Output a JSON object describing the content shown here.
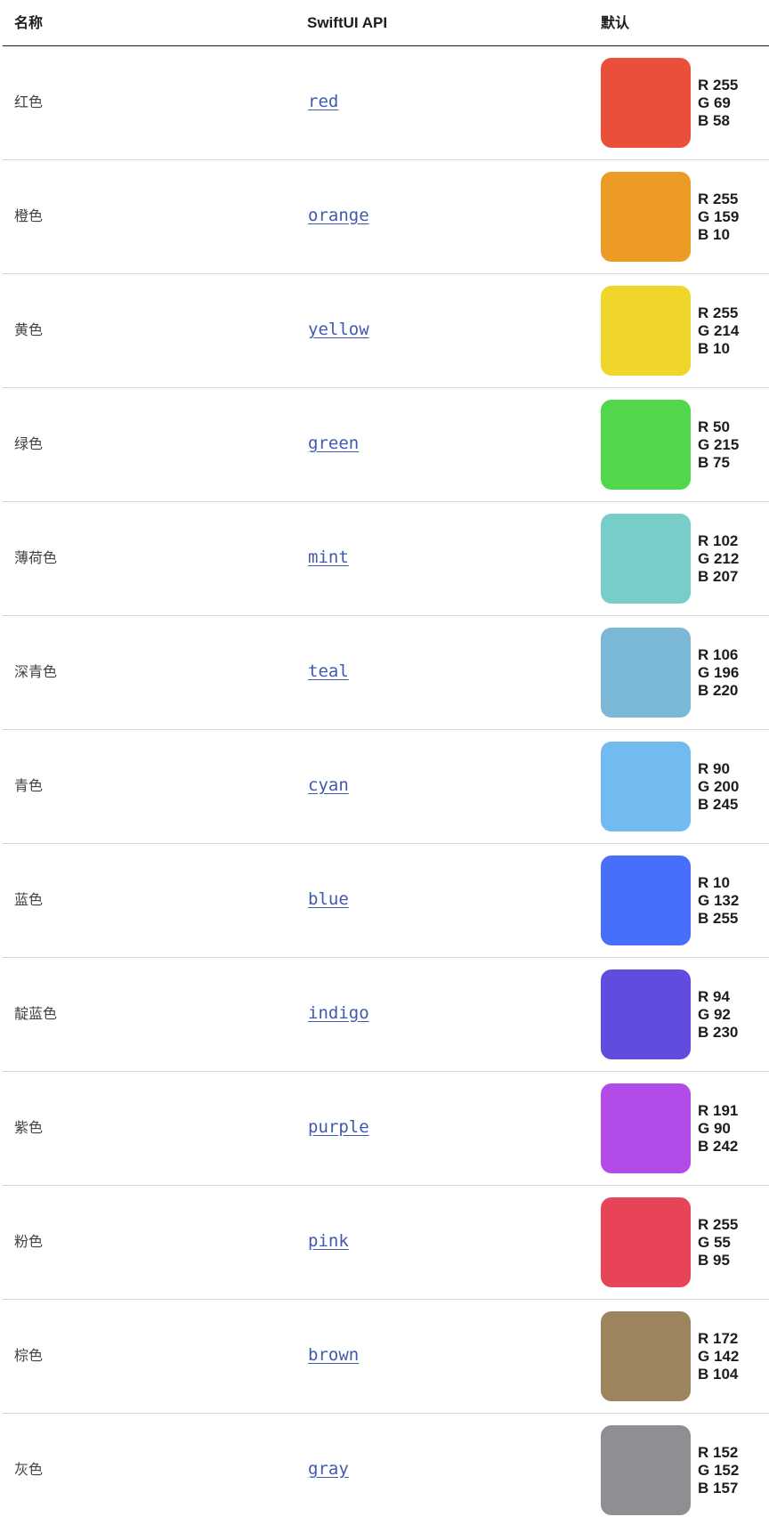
{
  "header": {
    "name": "名称",
    "api": "SwiftUI API",
    "default": "默认"
  },
  "rows": [
    {
      "name": "红色",
      "api": "red",
      "r": "R 255",
      "g": "G 69",
      "b": "B 58",
      "color": "#EA4F39"
    },
    {
      "name": "橙色",
      "api": "orange",
      "r": "R 255",
      "g": "G 159",
      "b": "B 10",
      "color": "#EC9C25"
    },
    {
      "name": "黄色",
      "api": "yellow",
      "r": "R 255",
      "g": "G 214",
      "b": "B 10",
      "color": "#F0D62B"
    },
    {
      "name": "绿色",
      "api": "green",
      "r": "R 50",
      "g": "G 215",
      "b": "B 75",
      "color": "#51D64C"
    },
    {
      "name": "薄荷色",
      "api": "mint",
      "r": "R 102",
      "g": "G 212",
      "b": "B 207",
      "color": "#79CDC8"
    },
    {
      "name": "深青色",
      "api": "teal",
      "r": "R 106",
      "g": "G 196",
      "b": "B 220",
      "color": "#7AB8D6"
    },
    {
      "name": "青色",
      "api": "cyan",
      "r": "R 90",
      "g": "G 200",
      "b": "B 245",
      "color": "#72BBF1"
    },
    {
      "name": "蓝色",
      "api": "blue",
      "r": "R 10",
      "g": "G 132",
      "b": "B 255",
      "color": "#486EFC"
    },
    {
      "name": "靛蓝色",
      "api": "indigo",
      "r": "R 94",
      "g": "G 92",
      "b": "B 230",
      "color": "#614CE0"
    },
    {
      "name": "紫色",
      "api": "purple",
      "r": "R 191",
      "g": "G 90",
      "b": "B 242",
      "color": "#B24BE8"
    },
    {
      "name": "粉色",
      "api": "pink",
      "r": "R 255",
      "g": "G 55",
      "b": "B 95",
      "color": "#E84458"
    },
    {
      "name": "棕色",
      "api": "brown",
      "r": "R 172",
      "g": "G 142",
      "b": "B 104",
      "color": "#9C845F"
    },
    {
      "name": "灰色",
      "api": "gray",
      "r": "R 152",
      "g": "G 152",
      "b": "B 157",
      "color": "#8E8E93"
    }
  ]
}
